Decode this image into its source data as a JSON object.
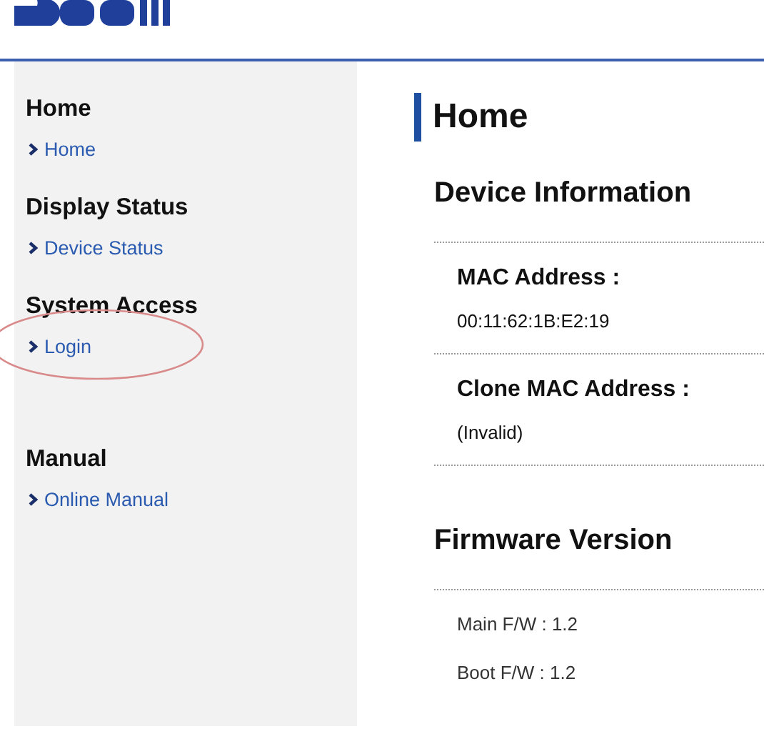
{
  "sidebar": {
    "sections": [
      {
        "heading": "Home",
        "spaced": false,
        "links": [
          {
            "label": "Home",
            "circled": false
          }
        ]
      },
      {
        "heading": "Display Status",
        "spaced": false,
        "links": [
          {
            "label": "Device Status",
            "circled": false
          }
        ]
      },
      {
        "heading": "System Access",
        "spaced": false,
        "links": [
          {
            "label": "Login",
            "circled": true
          }
        ]
      },
      {
        "heading": "Manual",
        "spaced": true,
        "links": [
          {
            "label": "Online Manual",
            "circled": false
          }
        ]
      }
    ]
  },
  "main": {
    "title": "Home",
    "sections": [
      {
        "heading": "Device Information",
        "kind": "fields",
        "items": [
          {
            "label": "MAC Address :",
            "value": "00:11:62:1B:E2:19"
          },
          {
            "label": "Clone MAC Address :",
            "value": "(Invalid)"
          }
        ]
      },
      {
        "heading": "Firmware Version",
        "kind": "lines",
        "items": [
          {
            "text": "Main F/W : 1.2"
          },
          {
            "text": "Boot F/W : 1.2"
          }
        ]
      }
    ]
  }
}
